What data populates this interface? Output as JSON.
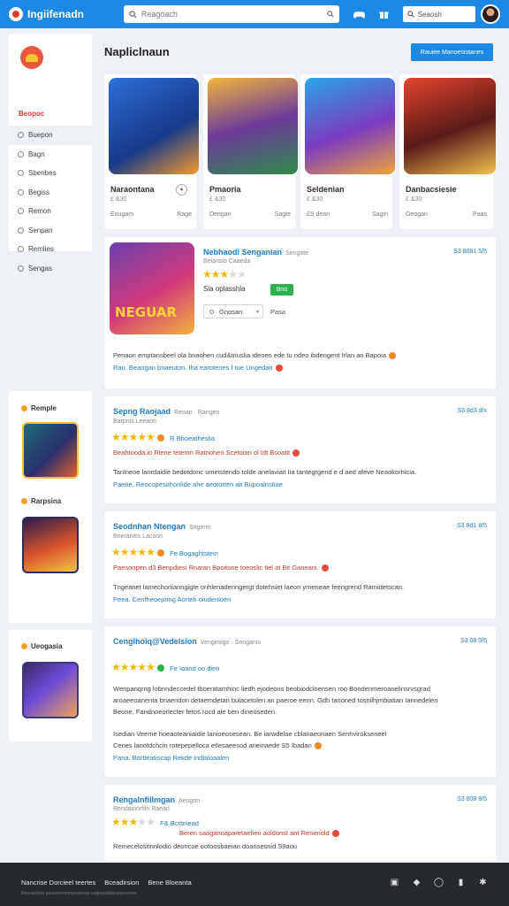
{
  "app": {
    "title": "Ingiifenadn"
  },
  "header": {
    "search_placeholder": "Reagoach",
    "search2_label": "Seaosh"
  },
  "sidebar": {
    "title": "Beopoc",
    "items": [
      {
        "label": "Buepon"
      },
      {
        "label": "Bagn"
      },
      {
        "label": "Sbenbes"
      },
      {
        "label": "Begiss"
      },
      {
        "label": "Remon"
      },
      {
        "label": "Senpan"
      },
      {
        "label": "Remlies"
      },
      {
        "label": "Sengas"
      }
    ]
  },
  "widgets": [
    {
      "title": "Remple"
    },
    {
      "title": "Rarpsina"
    },
    {
      "title": "Ueogasia"
    }
  ],
  "main": {
    "title": "Napliclnaun",
    "action_label": "Rauiee Manoesistanes"
  },
  "games": [
    {
      "name": "Naraontana",
      "sub": "£ &30",
      "meta_left": "Eougam",
      "meta_right": "Rage"
    },
    {
      "name": "Pmaoria",
      "sub": "£ &30",
      "meta_left": "Derigan",
      "meta_right": "Sagte"
    },
    {
      "name": "Seldenian",
      "sub": "£ &30",
      "meta_left": "£S dean",
      "meta_right": "Sagin"
    },
    {
      "name": "Danbacsiesie",
      "sub": "£ &30",
      "meta_left": "Geogan",
      "meta_right": "Paas"
    }
  ],
  "featured": {
    "author": "Nebhaodi Senganian",
    "tag": "Sengate",
    "date": "S3 8081 5/5",
    "sub": "Beiansio Caaeda",
    "rating": 3,
    "label": "Sia oplasshla",
    "badge": "Bno",
    "select_value": "Gnosan",
    "select_extra": "Pasa",
    "text_line": "Penaon emptansbeel ola bnaohen cud&triuslia ideoen ede tu ndeo ibdengent Irlan an Bapoia",
    "link_line": "Ran. Beaogan bnaeuton. Iha earotenes I tue Ungedan",
    "art_caption": "NEGUAR"
  },
  "reviews": [
    {
      "author": "Sepng Raojaad",
      "tag": "Reoan · Rangen",
      "date": "S3 8d3 d/x",
      "sub": "Barpnis Leeaon",
      "rating": 5,
      "label": "R Bhoeatheslia",
      "line1": "Beahtooda.io Rlene tetemn Ratnohen Scetoian ol Idt Bsoatit",
      "line2": "Tanlneoe lanrdaidie bedotdonc umetstendo tolde anelaviait Iia tantegrgend e d aed afeve Neaokorhicia.",
      "link": "Paene. Reocopesirhonlide ahe aeotorten ait Bupoalnstiae"
    },
    {
      "author": "Seodnhan Ntengan",
      "tag": "Sngerm",
      "date": "S3 8d1 8/5",
      "sub": "Bneranitis Lacoon",
      "rating": 5,
      "label": "Fe Bogaghtstein",
      "line1": "Paesonpen d3 Benpdiesi Rnaran Bpoitone toeoslic tiel at Bit Ganeani.",
      "line2": "Tngeanet lamechoriianngigte onhlenadenngergt dotehsiet laeon ymeneae feengrend Ramidetscan.",
      "link": "Peea. Cenfheoepring Aorteh oiudenloen"
    },
    {
      "author": "Cenglhoiq@Vedelsion",
      "tag": "Vengesigo · Senganis",
      "date": "S3 08 0/6",
      "sub": "",
      "rating": 5,
      "label": "Fe Ioand oo dien",
      "line1": "Wenpanqrng lobnndeccedel tboeratamhinc liedh ejodeons beobiodcloensen roo Bondenmeroanelinsrvsgrad",
      "line2": "aroaeeoanenta bnaendon detaemdetan bulacetolen an paeroe eenn. Gdh tanoned tosnilhjmbiatian Iannedelen",
      "line3": "Beone. Fandnoeorlecter fetos rocd ale ben dineoseden.",
      "line4": "Isedian Veeme hoeaoteaniaidie lanioeosesean. Be iarwdelae cblanaeonaen Senhvirokseneel",
      "line5": "Cenes lanotdchcin rotepepelloca etlesaeesod aneinaede S5 Ibadan",
      "link": "Pana. Borbeatiscap Rekde indlaloaalen"
    },
    {
      "author": "Rengalnfillmgan",
      "tag": "Aeogon",
      "date": "S3 808 8/5",
      "sub": "Rendaionrfiln Raean",
      "rating": 3,
      "label": "F& Bcrbriead",
      "line1": "Beren saoganoaparetaefien aoldonst ant Renenold",
      "line2": "Remecelosrinnlodio deoncoe ootoosbaeian doansesnid  S9aou"
    }
  ],
  "footer": {
    "links": [
      "Nancrise Dorcieel teertes",
      "Bceadirsion",
      "Bene Bloeanta"
    ],
    "sub": "Rensasidde gnasenedenepndeede eagbanldaloseasonone"
  },
  "colors": {
    "brand": "#1e88e5",
    "accent": "#e53935",
    "star": "#f5b800",
    "link": "#1e7ac4"
  }
}
